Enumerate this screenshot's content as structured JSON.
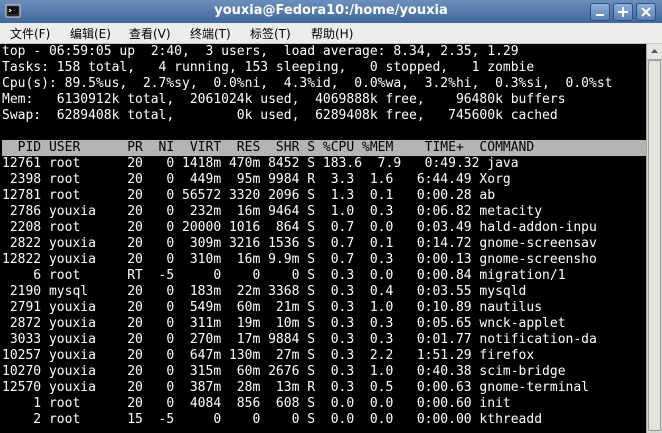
{
  "window": {
    "title": "youxia@Fedora10:/home/youxia",
    "buttons": {
      "minimize_icon": "minimize-icon",
      "maximize_icon": "maximize-icon",
      "close_icon": "close-icon"
    }
  },
  "menubar": {
    "items": [
      "文件(F)",
      "编辑(E)",
      "查看(V)",
      "终端(T)",
      "标签(T)",
      "帮助(H)"
    ]
  },
  "summary": {
    "lines": [
      "top - 06:59:05 up  2:40,  3 users,  load average: 8.34, 2.35, 1.29",
      "Tasks: 158 total,   4 running, 153 sleeping,   0 stopped,   1 zombie",
      "Cpu(s): 89.5%us,  2.7%sy,  0.0%ni,  4.3%id,  0.0%wa,  3.2%hi,  0.3%si,  0.0%st",
      "Mem:   6130912k total,  2061024k used,  4069888k free,    96480k buffers",
      "Swap:  6289408k total,        0k used,  6289408k free,   745600k cached"
    ]
  },
  "table": {
    "header": "  PID USER      PR  NI  VIRT  RES  SHR S %CPU %MEM    TIME+  COMMAND",
    "rows": [
      "12761 root      20   0 1418m 470m 8452 S 183.6  7.9   0:49.32 java",
      " 2398 root      20   0  449m  95m 9984 R  3.3  1.6   6:44.49 Xorg",
      "12781 root      20   0 56572 3320 2096 S  1.3  0.1   0:00.28 ab",
      " 2786 youxia    20   0  232m  16m 9464 S  1.0  0.3   0:06.82 metacity",
      " 2208 root      20   0 20000 1016  864 S  0.7  0.0   0:03.49 hald-addon-inpu",
      " 2822 youxia    20   0  309m 3216 1536 S  0.7  0.1   0:14.72 gnome-screensav",
      "12822 youxia    20   0  310m  16m 9.9m S  0.7  0.3   0:00.13 gnome-screensho",
      "    6 root      RT  -5     0    0    0 S  0.3  0.0   0:00.84 migration/1",
      " 2190 mysql     20   0  183m  22m 3368 S  0.3  0.4   0:03.55 mysqld",
      " 2791 youxia    20   0  549m  60m  21m S  0.3  1.0   0:10.89 nautilus",
      " 2872 youxia    20   0  311m  19m  10m S  0.3  0.3   0:05.65 wnck-applet",
      " 3033 youxia    20   0  270m  17m 9884 S  0.3  0.3   0:01.77 notification-da",
      "10257 youxia    20   0  647m 130m  27m S  0.3  2.2   1:51.29 firefox",
      "10270 youxia    20   0  315m  60m 2676 S  0.3  1.0   0:40.38 scim-bridge",
      "12570 youxia    20   0  387m  28m  13m R  0.3  0.5   0:00.63 gnome-terminal",
      "    1 root      20   0  4084  856  608 S  0.0  0.0   0:00.60 init",
      "    2 root      15  -5     0    0    0 S  0.0  0.0   0:00.00 kthreadd"
    ]
  },
  "colors": {
    "titlebar": "#4f76aa",
    "terminal_bg": "#000000",
    "terminal_fg": "#ffffff",
    "header_bg": "#b4b4b4"
  }
}
